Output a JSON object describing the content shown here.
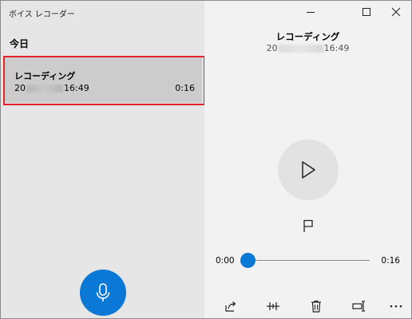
{
  "app": {
    "title": "ボイス レコーダー"
  },
  "list": {
    "section_header": "今日",
    "items": [
      {
        "name": "レコーディング",
        "date_prefix": "20",
        "time": "16:49",
        "duration": "0:16"
      }
    ]
  },
  "detail": {
    "title": "レコーディング",
    "date_prefix": "20",
    "time": "16:49"
  },
  "player": {
    "current_time": "0:00",
    "total_time": "0:16",
    "progress": 0
  },
  "icons": {
    "record": "microphone-icon",
    "play": "play-icon",
    "marker": "flag-icon",
    "share": "share-icon",
    "trim": "trim-icon",
    "delete": "delete-icon",
    "rename": "rename-icon",
    "more": "more-icon",
    "minimize": "minimize-icon",
    "maximize": "maximize-icon",
    "close": "close-icon"
  },
  "colors": {
    "accent": "#0a78d7",
    "selection_highlight": "#e0222a",
    "left_pane": "#e6e6e6",
    "right_pane": "#f2f2f2",
    "selected_item": "#cccccc"
  }
}
